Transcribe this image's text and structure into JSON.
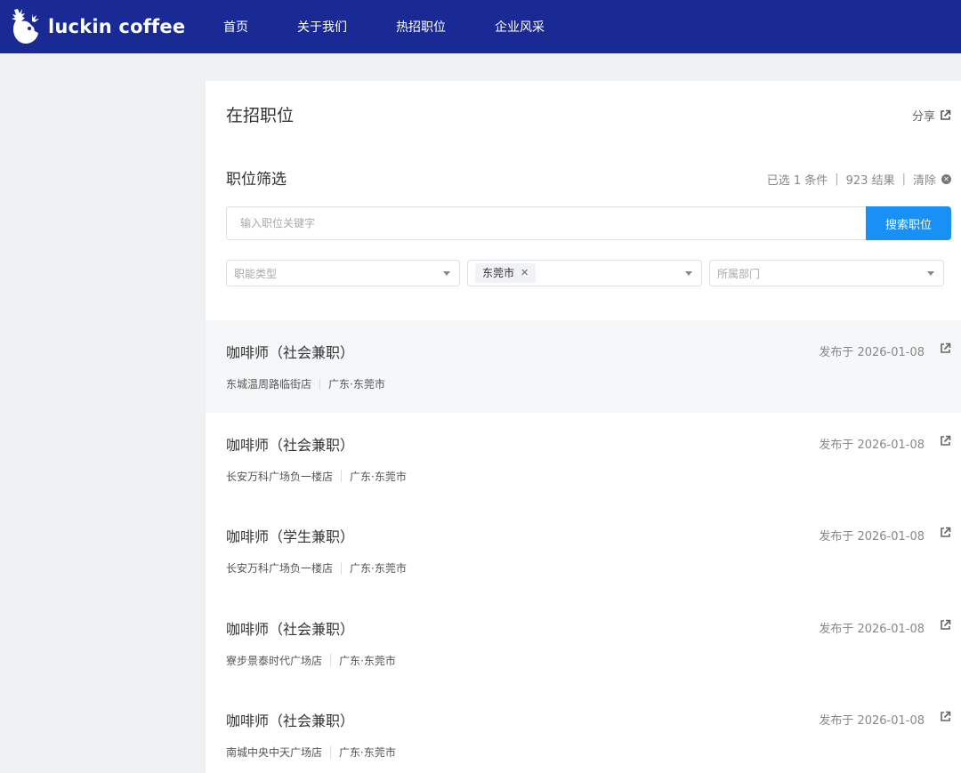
{
  "brand": {
    "name": "luckin coffee",
    "bg": "#1a2a94"
  },
  "nav": {
    "items": [
      "首页",
      "关于我们",
      "热招职位",
      "企业风采"
    ]
  },
  "page": {
    "title": "在招职位",
    "share_label": "分享"
  },
  "filter": {
    "title": "职位筛选",
    "summary_selected": "已选 1 条件",
    "summary_results": "923 结果",
    "clear_label": "清除",
    "separator": "|"
  },
  "search": {
    "placeholder": "输入职位关键字",
    "button_label": "搜索职位",
    "accent": "#1990f5"
  },
  "selects": [
    {
      "placeholder": "职能类型"
    },
    {
      "tag": "东莞市"
    },
    {
      "placeholder": "所属部门"
    }
  ],
  "jobs": [
    {
      "title": "咖啡师（社会兼职）",
      "date": "发布于 2026-01-08",
      "store": "东城温周路临街店",
      "location": "广东·东莞市"
    },
    {
      "title": "咖啡师（社会兼职）",
      "date": "发布于 2026-01-08",
      "store": "长安万科广场负一楼店",
      "location": "广东·东莞市"
    },
    {
      "title": "咖啡师（学生兼职）",
      "date": "发布于 2026-01-08",
      "store": "长安万科广场负一楼店",
      "location": "广东·东莞市"
    },
    {
      "title": "咖啡师（社会兼职）",
      "date": "发布于 2026-01-08",
      "store": "寮步景泰时代广场店",
      "location": "广东·东莞市"
    },
    {
      "title": "咖啡师（社会兼职）",
      "date": "发布于 2026-01-08",
      "store": "南城中央中天广场店",
      "location": "广东·东莞市"
    }
  ]
}
